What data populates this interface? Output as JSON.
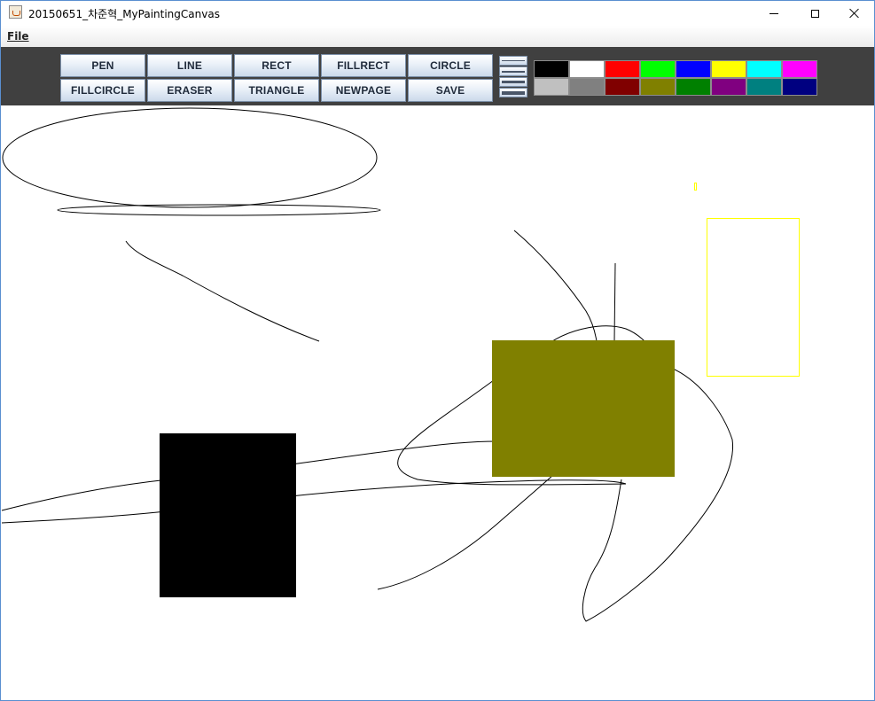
{
  "window": {
    "title": "20150651_차준혁_MyPaintingCanvas"
  },
  "menu": {
    "file_label": "File"
  },
  "tools": {
    "row1": [
      "PEN",
      "LINE",
      "RECT",
      "FILLRECT",
      "CIRCLE"
    ],
    "row2": [
      "FILLCIRCLE",
      "ERASER",
      "TRIANGLE",
      "NEWPAGE",
      "SAVE"
    ]
  },
  "thickness_options": [
    "thin",
    "medium",
    "thick",
    "extra-thick"
  ],
  "palette": {
    "row1": [
      "#000000",
      "#ffffff",
      "#ff0000",
      "#00ff00",
      "#0000ff",
      "#ffff00",
      "#00ffff",
      "#ff00ff"
    ],
    "row2": [
      "#c0c0c0",
      "#808080",
      "#800000",
      "#808000",
      "#008000",
      "#800080",
      "#008080",
      "#000080"
    ]
  },
  "canvas": {
    "stroke_color": "#000000",
    "shape_colors": {
      "black_rect": "#000000",
      "olive_rect": "#808000",
      "yellow_rect_outline": "#ffff00"
    }
  }
}
